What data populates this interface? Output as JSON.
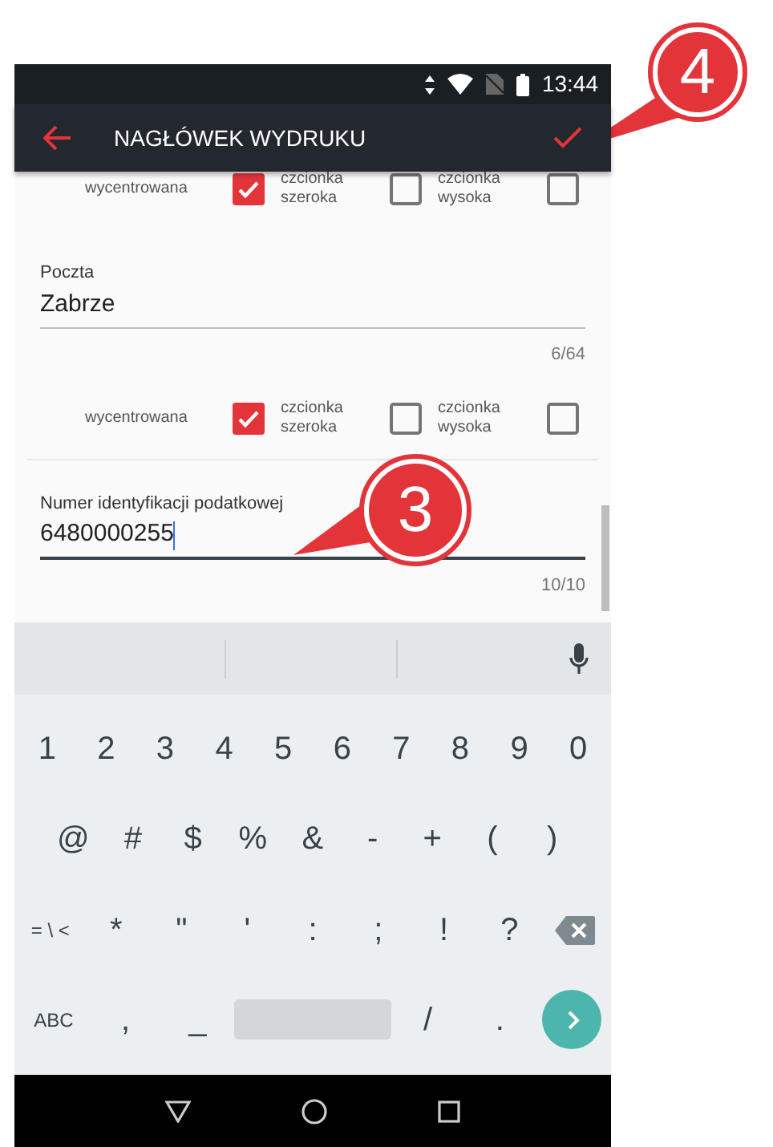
{
  "status_bar": {
    "time": "13:44"
  },
  "app_bar": {
    "title": "NAGŁÓWEK WYDRUKU"
  },
  "form": [
    {
      "kind": "options",
      "options": [
        {
          "label": "wycentrowana",
          "checked": true
        },
        {
          "label": "czcionka szeroka",
          "checked": false
        },
        {
          "label": "czcionka wysoka",
          "checked": false
        }
      ]
    },
    {
      "kind": "field",
      "label": "Poczta",
      "value": "Zabrze",
      "counter": "6/64",
      "focused": false
    },
    {
      "kind": "options",
      "options": [
        {
          "label": "wycentrowana",
          "checked": true
        },
        {
          "label": "czcionka szeroka",
          "checked": false
        },
        {
          "label": "czcionka wysoka",
          "checked": false
        }
      ]
    },
    {
      "kind": "field",
      "label": "Numer identyfikacji podatkowej",
      "value": "6480000255",
      "counter": "10/10",
      "focused": true
    }
  ],
  "keyboard": {
    "rows": [
      [
        {
          "kind": "char",
          "label": "1"
        },
        {
          "kind": "char",
          "label": "2"
        },
        {
          "kind": "char",
          "label": "3"
        },
        {
          "kind": "char",
          "label": "4"
        },
        {
          "kind": "char",
          "label": "5"
        },
        {
          "kind": "char",
          "label": "6"
        },
        {
          "kind": "char",
          "label": "7"
        },
        {
          "kind": "char",
          "label": "8"
        },
        {
          "kind": "char",
          "label": "9"
        },
        {
          "kind": "char",
          "label": "0"
        }
      ],
      [
        {
          "kind": "char",
          "label": "@"
        },
        {
          "kind": "char",
          "label": "#"
        },
        {
          "kind": "char",
          "label": "$"
        },
        {
          "kind": "char",
          "label": "%"
        },
        {
          "kind": "char",
          "label": "&"
        },
        {
          "kind": "char",
          "label": "-"
        },
        {
          "kind": "char",
          "label": "+"
        },
        {
          "kind": "char",
          "label": "("
        },
        {
          "kind": "char",
          "label": ")"
        }
      ],
      [
        {
          "kind": "small",
          "label": "= \\ <"
        },
        {
          "kind": "char",
          "label": "*"
        },
        {
          "kind": "char",
          "label": "\""
        },
        {
          "kind": "char",
          "label": "'"
        },
        {
          "kind": "char",
          "label": ":"
        },
        {
          "kind": "char",
          "label": ";"
        },
        {
          "kind": "char",
          "label": "!"
        },
        {
          "kind": "char",
          "label": "?"
        },
        {
          "kind": "backspace"
        }
      ],
      [
        {
          "kind": "small",
          "label": "ABC"
        },
        {
          "kind": "char",
          "label": ","
        },
        {
          "kind": "char",
          "label": "_"
        },
        {
          "kind": "space"
        },
        {
          "kind": "char",
          "label": "/"
        },
        {
          "kind": "char",
          "label": "."
        },
        {
          "kind": "go"
        }
      ]
    ]
  },
  "callouts": [
    {
      "label": "4"
    },
    {
      "label": "3"
    }
  ]
}
